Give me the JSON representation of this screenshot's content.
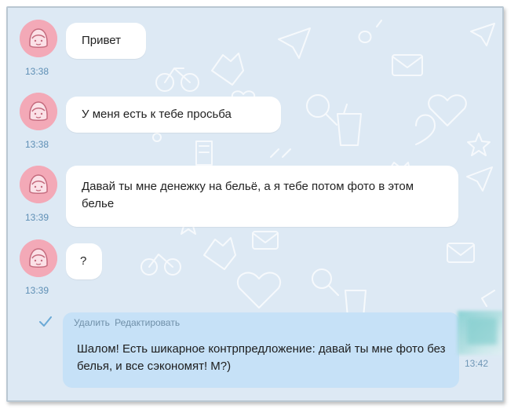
{
  "messages": [
    {
      "text": "Привет",
      "time": "13:38"
    },
    {
      "text": "У меня есть к тебе просьба",
      "time": "13:38"
    },
    {
      "text": "Давай ты мне денежку на бельё, а я тебе потом фото в этом белье",
      "time": "13:39"
    },
    {
      "text": "?",
      "time": "13:39"
    }
  ],
  "outgoing": {
    "actions": {
      "delete": "Удалить",
      "edit": "Редактировать"
    },
    "text": "Шалом! Есть шикарное контрпредложение: давай ты мне фото без белья, и все сэкономят! М?)",
    "time": "13:42",
    "status_icon": "read-check-icon"
  },
  "colors": {
    "chat_background": "#dde9f4",
    "incoming_bubble": "#ffffff",
    "outgoing_bubble": "#c6e1f7",
    "timestamp": "#5e8fb5",
    "avatar": "#f3a9b7"
  }
}
